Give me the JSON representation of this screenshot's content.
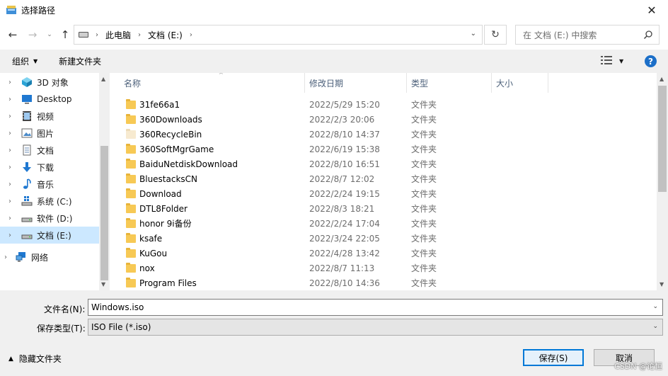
{
  "window": {
    "title": "选择路径",
    "close_glyph": "✕"
  },
  "nav": {
    "back_glyph": "←",
    "forward_glyph": "→",
    "recent_glyph": "⌄",
    "up_glyph": "↑",
    "breadcrumb": [
      "此电脑",
      "文档 (E:)"
    ],
    "breadcrumb_sep": "›",
    "dropdown_glyph": "⌄",
    "refresh_glyph": "↻",
    "search_placeholder": "在 文档 (E:) 中搜索"
  },
  "toolbar": {
    "organize_label": "组织",
    "caret_glyph": "▼",
    "new_folder_label": "新建文件夹",
    "help_glyph": "?"
  },
  "sidebar": {
    "items": [
      {
        "label": "3D 对象",
        "icon": "cube-3d-icon"
      },
      {
        "label": "Desktop",
        "icon": "desktop-icon"
      },
      {
        "label": "视频",
        "icon": "video-icon"
      },
      {
        "label": "图片",
        "icon": "picture-icon"
      },
      {
        "label": "文档",
        "icon": "document-icon"
      },
      {
        "label": "下载",
        "icon": "download-icon"
      },
      {
        "label": "音乐",
        "icon": "music-icon"
      },
      {
        "label": "系统 (C:)",
        "icon": "system-drive-icon"
      },
      {
        "label": "软件 (D:)",
        "icon": "drive-icon"
      },
      {
        "label": "文档 (E:)",
        "icon": "drive-icon",
        "selected": true
      },
      {
        "label": "网络",
        "icon": "network-icon"
      }
    ],
    "expand_glyph": "›"
  },
  "files": {
    "columns": {
      "name": "名称",
      "date": "修改日期",
      "type": "类型",
      "size": "大小"
    },
    "sort_glyph": "^",
    "rows": [
      {
        "name": "31fe66a1",
        "date": "2022/5/29 15:20",
        "type": "文件夹"
      },
      {
        "name": "360Downloads",
        "date": "2022/2/3 20:06",
        "type": "文件夹"
      },
      {
        "name": "360RecycleBin",
        "date": "2022/8/10 14:37",
        "type": "文件夹",
        "hidden": true
      },
      {
        "name": "360SoftMgrGame",
        "date": "2022/6/19 15:38",
        "type": "文件夹"
      },
      {
        "name": "BaiduNetdiskDownload",
        "date": "2022/8/10 16:51",
        "type": "文件夹"
      },
      {
        "name": "BluestacksCN",
        "date": "2022/8/7 12:02",
        "type": "文件夹"
      },
      {
        "name": "Download",
        "date": "2022/2/24 19:15",
        "type": "文件夹"
      },
      {
        "name": "DTL8Folder",
        "date": "2022/8/3 18:21",
        "type": "文件夹"
      },
      {
        "name": "honor 9i备份",
        "date": "2022/2/24 17:04",
        "type": "文件夹"
      },
      {
        "name": "ksafe",
        "date": "2022/3/24 22:05",
        "type": "文件夹"
      },
      {
        "name": "KuGou",
        "date": "2022/4/28 13:42",
        "type": "文件夹"
      },
      {
        "name": "nox",
        "date": "2022/8/7 11:13",
        "type": "文件夹"
      },
      {
        "name": "Program Files",
        "date": "2022/8/10 14:36",
        "type": "文件夹"
      }
    ]
  },
  "scroll": {
    "up_glyph": "▲",
    "down_glyph": "▼"
  },
  "bottom": {
    "filename_label": "文件名(N):",
    "filename_value": "Windows.iso",
    "filetype_label": "保存类型(T):",
    "filetype_value": "ISO File (*.iso)",
    "hide_folders_label": "隐藏文件夹",
    "hide_caret_glyph": "▲",
    "save_label": "保存(S)",
    "cancel_label": "取消",
    "watermark": "CSDN @论恒"
  },
  "colors": {
    "accent": "#0078d7",
    "selected_bg": "#cce8ff",
    "folder": "#f7c955",
    "help_blue": "#1c6fc8"
  }
}
